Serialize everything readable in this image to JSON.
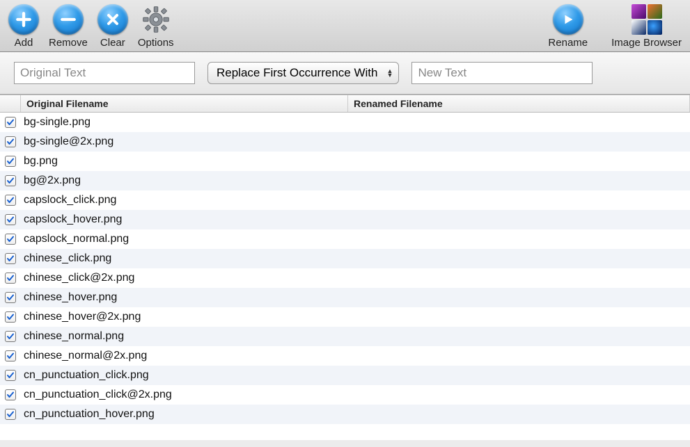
{
  "toolbar": {
    "add": {
      "label": "Add"
    },
    "remove": {
      "label": "Remove"
    },
    "clear": {
      "label": "Clear"
    },
    "options": {
      "label": "Options"
    },
    "rename": {
      "label": "Rename"
    },
    "imageBrowser": {
      "label": "Image Browser"
    }
  },
  "filter": {
    "originalPlaceholder": "Original Text",
    "modeLabel": "Replace First Occurrence With",
    "newPlaceholder": "New Text"
  },
  "columns": {
    "original": "Original Filename",
    "renamed": "Renamed Filename"
  },
  "files": [
    {
      "checked": true,
      "original": "bg-single.png",
      "renamed": ""
    },
    {
      "checked": true,
      "original": "bg-single@2x.png",
      "renamed": ""
    },
    {
      "checked": true,
      "original": "bg.png",
      "renamed": ""
    },
    {
      "checked": true,
      "original": "bg@2x.png",
      "renamed": ""
    },
    {
      "checked": true,
      "original": "capslock_click.png",
      "renamed": ""
    },
    {
      "checked": true,
      "original": "capslock_hover.png",
      "renamed": ""
    },
    {
      "checked": true,
      "original": "capslock_normal.png",
      "renamed": ""
    },
    {
      "checked": true,
      "original": "chinese_click.png",
      "renamed": ""
    },
    {
      "checked": true,
      "original": "chinese_click@2x.png",
      "renamed": ""
    },
    {
      "checked": true,
      "original": "chinese_hover.png",
      "renamed": ""
    },
    {
      "checked": true,
      "original": "chinese_hover@2x.png",
      "renamed": ""
    },
    {
      "checked": true,
      "original": "chinese_normal.png",
      "renamed": ""
    },
    {
      "checked": true,
      "original": "chinese_normal@2x.png",
      "renamed": ""
    },
    {
      "checked": true,
      "original": "cn_punctuation_click.png",
      "renamed": ""
    },
    {
      "checked": true,
      "original": "cn_punctuation_click@2x.png",
      "renamed": ""
    },
    {
      "checked": true,
      "original": "cn_punctuation_hover.png",
      "renamed": ""
    }
  ]
}
